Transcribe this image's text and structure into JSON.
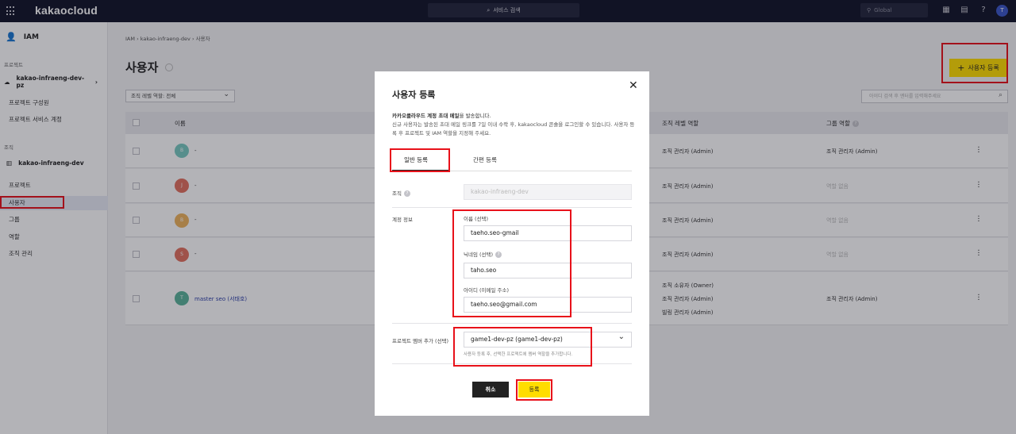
{
  "topbar": {
    "brand": "kakaocloud",
    "search_label": "서비스 검색",
    "region": "Global",
    "avatar": "T"
  },
  "sidebar": {
    "service": "IAM",
    "project_section": "프로젝트",
    "project_name": "kakao-infraeng-dev-pz",
    "project_items": [
      "프로젝트 구성원",
      "프로젝트 서비스 계정"
    ],
    "org_section": "조직",
    "org_name": "kakao-infraeng-dev",
    "org_items": [
      "프로젝트",
      "사용자",
      "그룹",
      "역할",
      "조직 관리"
    ]
  },
  "breadcrumb": [
    "IAM",
    "kakao-infraeng-dev",
    "사용자"
  ],
  "page_title": "사용자",
  "add_button": "사용자 등록",
  "filter_label": "조직 레벨 역할: 전체",
  "search_placeholder": "아이디 검색 후 엔터를 입력해주세요",
  "table": {
    "col_name": "이름",
    "col_org_role": "조직 레벨 역할",
    "col_group_role": "그룹 역할",
    "rows": [
      {
        "avatar": "B",
        "color": "#78c9c0",
        "name": "-",
        "org_roles": [
          "조직 관리자 (Admin)"
        ],
        "group_role": "조직 관리자 (Admin)"
      },
      {
        "avatar": "J",
        "color": "#e2705f",
        "name": "-",
        "org_roles": [
          "조직 관리자 (Admin)"
        ],
        "group_role": "역할 없음"
      },
      {
        "avatar": "B",
        "color": "#eeb35c",
        "name": "-",
        "org_roles": [
          "조직 관리자 (Admin)"
        ],
        "group_role": "역할 없음"
      },
      {
        "avatar": "S",
        "color": "#e2705f",
        "name": "-",
        "org_roles": [
          "조직 관리자 (Admin)"
        ],
        "group_role": "역할 없음"
      },
      {
        "avatar": "T",
        "color": "#5ab39a",
        "name": "master seo (서태호)",
        "org_roles": [
          "조직 소유자 (Owner)",
          "조직 관리자 (Admin)",
          "빌링 관리자 (Admin)"
        ],
        "group_role": "조직 관리자 (Admin)"
      }
    ]
  },
  "modal": {
    "title": "사용자 등록",
    "desc_line1_pre": "카카오클라우드 계정 초대 메일",
    "desc_line1_post": "을 발송합니다.",
    "desc_line2": "신규 사용자는 발송된 초대 메일 링크를 7일 이내 수락 후, kakaocloud 콘솔을 로그인할 수 있습니다. 사용자 등록 후 프로젝트 및 IAM 역할을 지정해 주세요.",
    "tab_general": "일반 등록",
    "tab_simple": "간편 등록",
    "org_label": "조직",
    "org_value": "kakao-infraeng-dev",
    "account_label": "계정 정보",
    "name_label": "이름 (선택)",
    "name_value": "taeho.seo-gmail",
    "nickname_label": "닉네임 (선택)",
    "nickname_value": "taho.seo",
    "id_label": "아이디 (이메일 주소)",
    "id_value": "taeho.seo@gmail.com",
    "project_label": "프로젝트 멤버 추가 (선택)",
    "project_value": "game1-dev-pz (game1-dev-pz)",
    "project_hint": "사용자 등록 후, 선택한 프로젝트에 멤버 역할을 추가합니다.",
    "cancel": "취소",
    "submit": "등록"
  },
  "colors": {
    "highlight": "#e8111a",
    "accent": "#ffdd00",
    "topbar": "#111428"
  }
}
